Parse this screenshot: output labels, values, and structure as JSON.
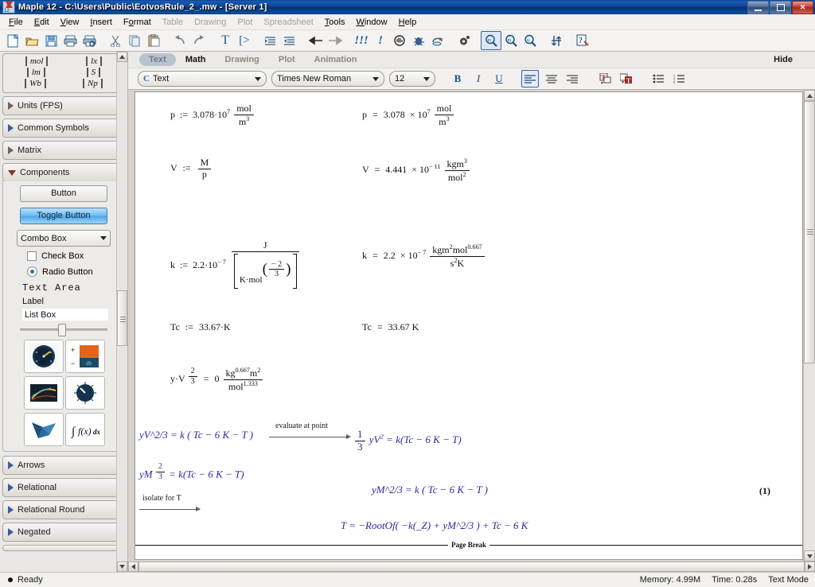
{
  "window": {
    "title": "Maple 12 - C:\\Users\\Public\\EotvosRule_2_.mw - [Server 1]",
    "icon": "maple-logo-icon",
    "minimize": "—",
    "maximize": "❐",
    "close": "✕"
  },
  "menubar": [
    {
      "label": "File",
      "enabled": true
    },
    {
      "label": "Edit",
      "enabled": true
    },
    {
      "label": "View",
      "enabled": true
    },
    {
      "label": "Insert",
      "enabled": true
    },
    {
      "label": "Format",
      "enabled": true
    },
    {
      "label": "Table",
      "enabled": false
    },
    {
      "label": "Drawing",
      "enabled": false
    },
    {
      "label": "Plot",
      "enabled": false
    },
    {
      "label": "Spreadsheet",
      "enabled": false
    },
    {
      "label": "Tools",
      "enabled": true
    },
    {
      "label": "Window",
      "enabled": true
    },
    {
      "label": "Help",
      "enabled": true
    }
  ],
  "toolbar": {
    "buttons": [
      "new-document-icon",
      "open-folder-icon",
      "save-icon",
      "print-icon",
      "print-preview-icon",
      "cut-scissors-icon",
      "copy-icon",
      "paste-icon",
      "undo-icon",
      "redo-icon",
      "text-mode-icon",
      "math-mode-icon",
      "indent-increase-icon",
      "indent-decrease-icon",
      "back-arrow-icon",
      "forward-arrow-icon",
      "execute-all-icon",
      "execute-selection-icon",
      "interrupt-hand-icon",
      "debug-icon",
      "restart-server-icon",
      "settings-gear-icon",
      "zoom-100-icon",
      "zoom-in-icon",
      "zoom-out-icon",
      "toggle-input-output-icon",
      "help-query-icon"
    ],
    "selected": "zoom-100-icon"
  },
  "context": {
    "tabs": [
      {
        "label": "Text",
        "state": "active"
      },
      {
        "label": "Math",
        "state": "bold"
      },
      {
        "label": "Drawing",
        "state": "disabled"
      },
      {
        "label": "Plot",
        "state": "disabled"
      },
      {
        "label": "Animation",
        "state": "disabled"
      }
    ],
    "hide_label": "Hide"
  },
  "format": {
    "style_icon": "C",
    "style_value": "Text",
    "font_value": "Times New Roman",
    "size_value": "12",
    "bold": "B",
    "italic": "I",
    "underline": "U",
    "align_left": "align-left-icon",
    "align_center": "align-center-icon",
    "align_right": "align-right-icon",
    "text_color": "text-color-icon",
    "highlight_color": "highlight-color-icon",
    "bullet_list": "bullet-list-icon",
    "numbered_list": "numbered-list-icon"
  },
  "palette": {
    "symbol_grid": [
      [
        "mol",
        "lx"
      ],
      [
        "lm",
        "S"
      ],
      [
        "Wb",
        "Np"
      ]
    ],
    "sections": [
      {
        "label": "Units (FPS)",
        "expanded": false,
        "tri": "red"
      },
      {
        "label": "Common Symbols",
        "expanded": false,
        "tri": "blue"
      },
      {
        "label": "Matrix",
        "expanded": false,
        "tri": "red"
      },
      {
        "label": "Components",
        "expanded": true,
        "tri": "red"
      }
    ],
    "components": {
      "button": "Button",
      "toggle_button": "Toggle Button",
      "combo_box": "Combo Box",
      "check_box": "Check Box",
      "radio_button": "Radio Button",
      "text_area": "Text Area",
      "label": "Label",
      "list_box": "List Box",
      "slider": "slider-control",
      "icons": [
        "gauge-dial-icon",
        "volume-meter-icon",
        "plot-2d-icon",
        "rotary-knob-icon",
        "plot-3d-icon",
        "math-expression-icon"
      ]
    },
    "lower_sections": [
      {
        "label": "Arrows",
        "tri": "blue"
      },
      {
        "label": "Relational",
        "tri": "blue"
      },
      {
        "label": "Relational Round",
        "tri": "blue"
      },
      {
        "label": "Negated",
        "tri": "blue"
      }
    ]
  },
  "document": {
    "equations": [
      {
        "id": "rho-assign",
        "input": "p := 3.078·10^7 mol/m^3",
        "output": "p = 3.078 × 10^7 mol/m^3"
      },
      {
        "id": "V-assign",
        "input": "V := M/p",
        "output": "V = 4.441 × 10^-11 kg m^3 / mol^2"
      },
      {
        "id": "k-assign",
        "input": "k := 2.2·10^-7 J / [K·mol^(-2/3)]",
        "output": "k = 2.2 × 10^-7 kg m^2 mol^0.667 / s^2 K"
      },
      {
        "id": "Tc-assign",
        "input": "Tc := 33.67·K",
        "output": "Tc = 33.67 K"
      },
      {
        "id": "yV-expr",
        "input": "y·V^(2/3) = 0 kg^0.667 m^2 / mol^1.333"
      }
    ],
    "derivation": {
      "line1_left": "yV^2/3 = k ( Tc − 6 K − T )",
      "arrow1_label": "evaluate at point",
      "line1_right": "1/3 yV^2 = k ( Tc − 6 K − T )",
      "line2_left": "yM^(2/3) = k ( Tc − 6 K − T )",
      "line2_right": "yM^2/3 = k ( Tc − 6 K − T )",
      "arrow2_label": "isolate for T",
      "line3_right": "T = −RootOf( −k(_Z) + yM^2/3 ) + Tc − 6 K",
      "equation_number": "(1)"
    },
    "page_break_label": "Page Break",
    "symbols": {
      "p": "p",
      "V": "V",
      "M": "M",
      "k": "k",
      "Tc": "Tc",
      "y": "y",
      "T": "T",
      "mol": "mol",
      "m": "m",
      "kg": "kg",
      "K": "K",
      "s": "s",
      "J": "J",
      "assign": ":=",
      "equals": "=",
      "times": "×",
      "minus": "−"
    },
    "numbers": {
      "rho_mantissa": "3.078",
      "rho_exp": "7",
      "rho_den_exp": "3",
      "V_mantissa": "4.441",
      "V_exp": "− 11",
      "V_num_exp": "3",
      "V_den_exp": "2",
      "k_mantissa": "2.2",
      "k_exp": "− 7",
      "k_m_exp": "2",
      "k_mol_exp": "0.667",
      "k_s_exp": "2",
      "k_in_num": "− 2",
      "k_in_den": "3",
      "Tc_value": "33.67",
      "y_exp_num": "2",
      "y_exp_den": "3",
      "yV_zero": "0",
      "yV_kg_exp": "0.667",
      "yV_m_exp": "2",
      "yV_mol_exp": "1.333",
      "third_num": "1",
      "third_den": "3",
      "two_thirds_num": "2",
      "two_thirds_den": "3",
      "six": "6",
      "pow23": "2/3"
    }
  },
  "status": {
    "ready": "Ready",
    "memory": "Memory: 4.99M",
    "time": "Time: 0.28s",
    "mode": "Text Mode"
  },
  "colors": {
    "title_blue": "#0a418f",
    "math_blue": "#2a2a9c",
    "accent_selected": "#b9c3cf",
    "toolbar_bg": "#f4f3f1",
    "page_bg": "#ffffff"
  }
}
